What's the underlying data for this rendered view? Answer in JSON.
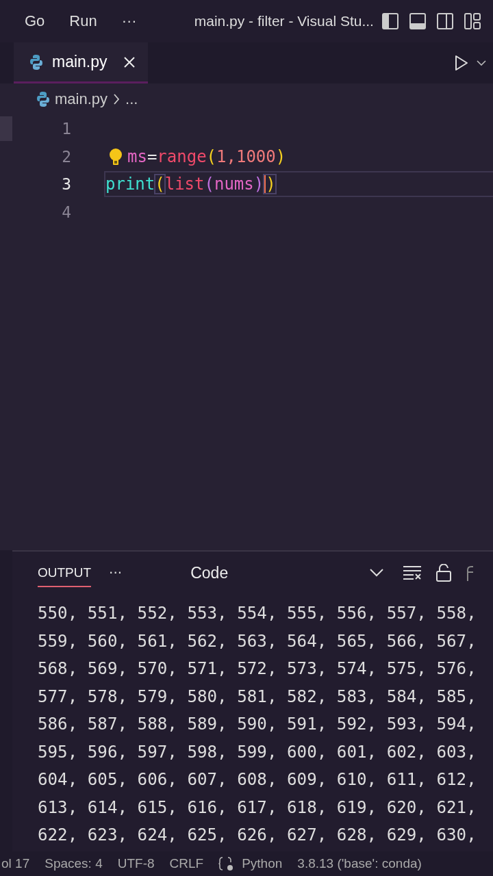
{
  "title_bar": {
    "menu": [
      "Go",
      "Run",
      "···"
    ],
    "title": "main.py - filter - Visual Stu..."
  },
  "tabs": [
    {
      "label": "main.py",
      "selected": true
    }
  ],
  "breadcrumb": {
    "file": "main.py",
    "rest": "..."
  },
  "editor": {
    "lines": [
      {
        "number": "1",
        "current": false
      },
      {
        "number": "2",
        "current": false,
        "lightbulb": true,
        "tokens": [
          {
            "text": "ms",
            "kind": "variable"
          },
          {
            "text": "=",
            "kind": "operator"
          },
          {
            "text": "range",
            "kind": "function"
          },
          {
            "text": "(",
            "kind": "paren"
          },
          {
            "text": "1,1000",
            "kind": "number"
          },
          {
            "text": ")",
            "kind": "paren"
          }
        ]
      },
      {
        "number": "3",
        "current": true,
        "tokens": [
          {
            "text": "print",
            "kind": "builtin"
          },
          {
            "text": "(",
            "kind": "match"
          },
          {
            "text": "list",
            "kind": "function"
          },
          {
            "text": "(",
            "kind": "paren2"
          },
          {
            "text": "nums",
            "kind": "variable"
          },
          {
            "text": ")",
            "kind": "paren2"
          },
          {
            "text": ")",
            "kind": "match-cursor"
          }
        ]
      },
      {
        "number": "4",
        "current": false
      }
    ]
  },
  "panel": {
    "tabs": [
      {
        "label": "OUTPUT",
        "selected": true
      }
    ],
    "more": "···",
    "channel": "Code",
    "output": [
      "550, 551, 552, 553, 554, 555, 556, 557, 558,",
      "559, 560, 561, 562, 563, 564, 565, 566, 567,",
      "568, 569, 570, 571, 572, 573, 574, 575, 576,",
      "577, 578, 579, 580, 581, 582, 583, 584, 585,",
      "586, 587, 588, 589, 590, 591, 592, 593, 594,",
      "595, 596, 597, 598, 599, 600, 601, 602, 603,",
      "604, 605, 606, 607, 608, 609, 610, 611, 612,",
      "613, 614, 615, 616, 617, 618, 619, 620, 621,",
      "622, 623, 624, 625, 626, 627, 628, 629, 630,"
    ]
  },
  "status_bar": [
    {
      "text": "ol 17",
      "kind": "text"
    },
    {
      "text": "Spaces: 4",
      "kind": "text"
    },
    {
      "text": "UTF-8",
      "kind": "text"
    },
    {
      "text": "CRLF",
      "kind": "text"
    },
    {
      "text": "Python",
      "kind": "language"
    },
    {
      "text": "3.8.13 ('base': conda)",
      "kind": "text"
    }
  ]
}
